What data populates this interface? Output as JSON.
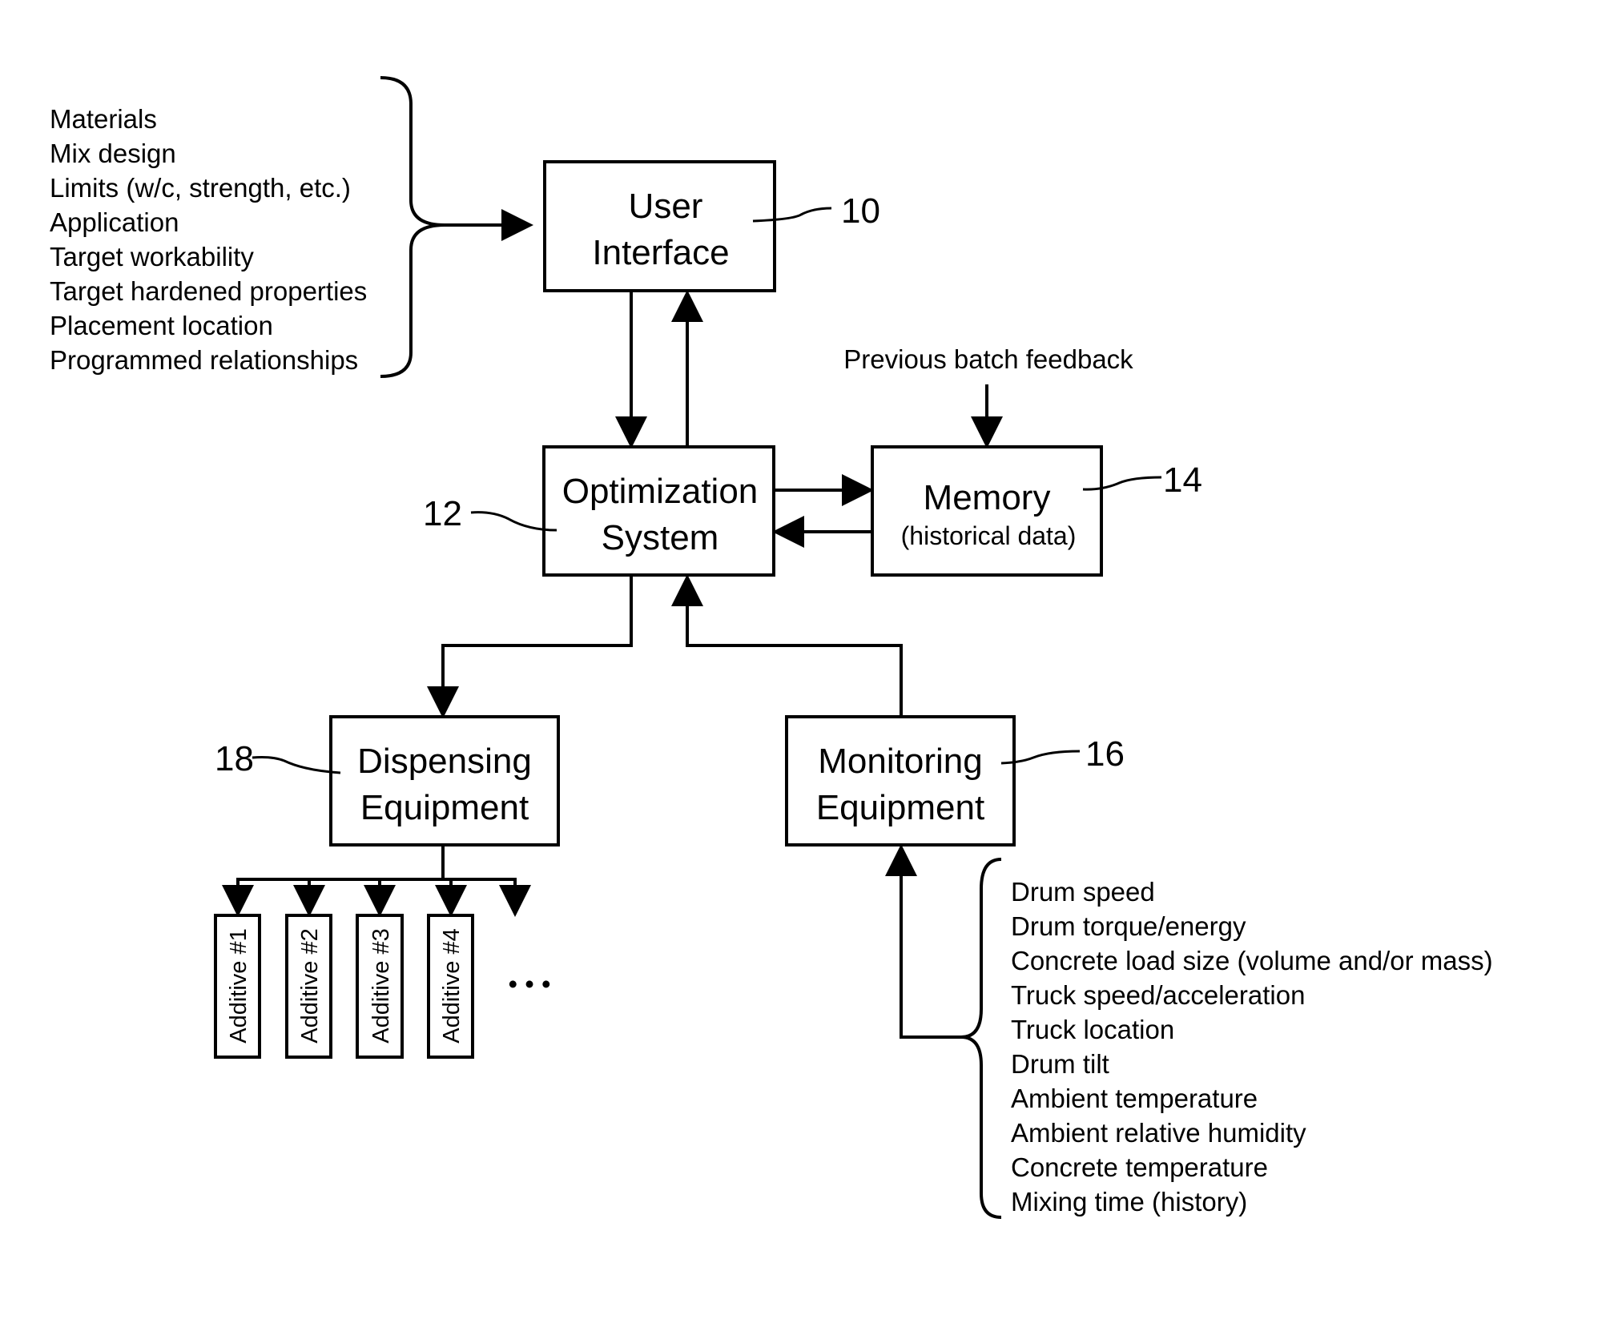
{
  "diagram": {
    "input_list": [
      "Materials",
      "Mix design",
      "Limits (w/c, strength, etc.)",
      "Application",
      "Target workability",
      "Target hardened properties",
      "Placement location",
      "Programmed relationships"
    ],
    "boxes": {
      "user_interface": {
        "line1": "User",
        "line2": "Interface",
        "ref": "10"
      },
      "optimization": {
        "line1": "Optimization",
        "line2": "System",
        "ref": "12"
      },
      "memory": {
        "line1": "Memory",
        "line2": "(historical data)",
        "ref": "14"
      },
      "monitoring": {
        "line1": "Monitoring",
        "line2": "Equipment",
        "ref": "16"
      },
      "dispensing": {
        "line1": "Dispensing",
        "line2": "Equipment",
        "ref": "18"
      }
    },
    "feedback_label": "Previous batch feedback",
    "additives": [
      "Additive #1",
      "Additive #2",
      "Additive #3",
      "Additive #4"
    ],
    "ellipsis": "• • •",
    "monitoring_list": [
      "Drum speed",
      "Drum torque/energy",
      "Concrete load size (volume and/or mass)",
      "Truck speed/acceleration",
      "Truck location",
      "Drum tilt",
      "Ambient temperature",
      "Ambient relative humidity",
      "Concrete temperature",
      "Mixing time (history)"
    ]
  }
}
